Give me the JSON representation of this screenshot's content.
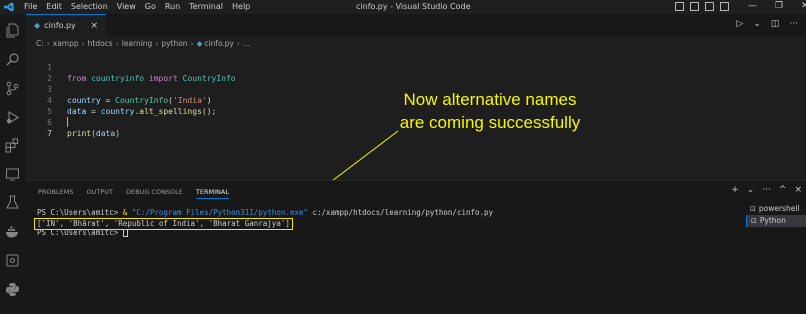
{
  "titlebar": {
    "menu": [
      "File",
      "Edit",
      "Selection",
      "View",
      "Go",
      "Run",
      "Terminal",
      "Help"
    ],
    "window_title": "cinfo.py - Visual Studio Code",
    "controls": [
      "—",
      "❐",
      "✕"
    ]
  },
  "tab": {
    "filename": "cinfo.py",
    "close": "×"
  },
  "breadcrumb": [
    "C:",
    "xampp",
    "htdocs",
    "learning",
    "python",
    "cinfo.py",
    "..."
  ],
  "code": {
    "line_numbers": [
      "1",
      "2",
      "3",
      "4",
      "5",
      "6",
      "7"
    ],
    "line1": {
      "kw1": "from",
      "mod": "countryinfo",
      "kw2": "import",
      "cls": "CountryInfo"
    },
    "line3": {
      "var": "country",
      "eq": " = ",
      "cls": "CountryInfo",
      "open": "(",
      "str": "'India'",
      "close": ")"
    },
    "line4": {
      "var": "data",
      "eq": " = ",
      "obj": "country",
      "dot": ".",
      "fn": "alt_spellings",
      "rest": "();"
    },
    "line6": {
      "fn": "print",
      "open": "(",
      "var": "data",
      "close": ")"
    }
  },
  "annotation": {
    "line1": "Now alternative names",
    "line2": "are coming successfully",
    "color": "#f7f700"
  },
  "panel": {
    "tabs": [
      "PROBLEMS",
      "OUTPUT",
      "DEBUG CONSOLE",
      "TERMINAL"
    ],
    "active_tab": "TERMINAL"
  },
  "terminal": {
    "line1_prompt": "PS C:\\Users\\amitc> ",
    "line1_amp": "& ",
    "line1_exe": "\"C:/Program Files/Python311/python.exe\"",
    "line1_path": " c:/xampp/htdocs/learning/python/cinfo.py",
    "line2_output": "['IN', 'Bhārat', 'Republic of India', 'Bharat Ganrajya']",
    "line3_prompt": "PS C:\\Users\\amitc> "
  },
  "terminal_list": [
    "powershell",
    "Python"
  ]
}
